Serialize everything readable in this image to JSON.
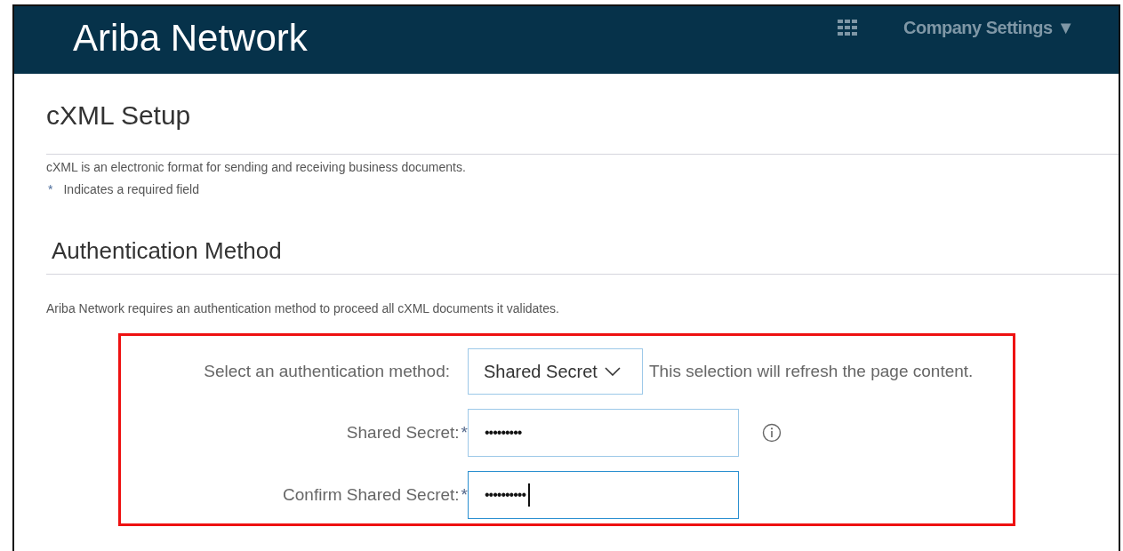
{
  "header": {
    "logo": "Ariba Network",
    "menu": "Company Settings ▼"
  },
  "page": {
    "title": "cXML Setup",
    "description": "cXML is an electronic format for sending and receiving business documents.",
    "required_mark": "*",
    "required_note": "Indicates a required field"
  },
  "section": {
    "title": "Authentication Method",
    "intro": "Ariba Network requires an authentication method to proceed all cXML documents it validates.",
    "method_row": {
      "label": "Select an authentication method:",
      "value": "Shared Secret",
      "hint": "This selection will refresh the page content."
    },
    "fields": [
      {
        "label": "Shared Secret:",
        "required": true,
        "value": "•••••••••",
        "focused": false,
        "info": true
      },
      {
        "label": "Confirm Shared Secret:",
        "required": true,
        "value": "••••••••••",
        "focused": true,
        "info": false
      }
    ]
  }
}
